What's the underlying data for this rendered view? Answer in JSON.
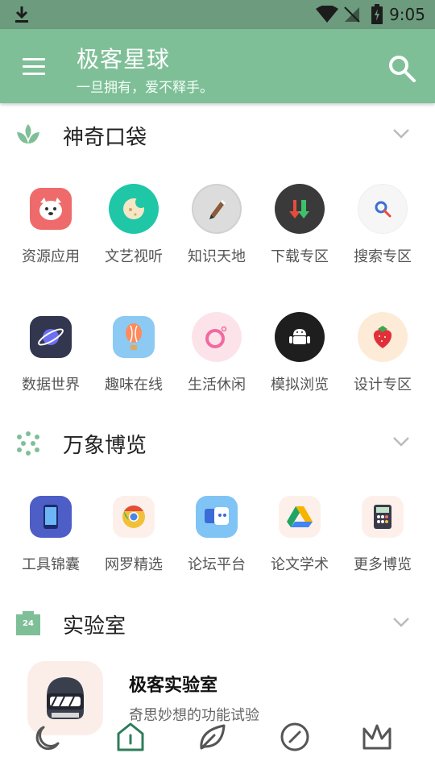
{
  "statusbar": {
    "time": "9:05"
  },
  "appbar": {
    "title": "极客星球",
    "subtitle": "一旦拥有，爱不释手。"
  },
  "sections": [
    {
      "title": "神奇口袋",
      "items": [
        {
          "label": "资源应用",
          "icon": "dog-icon"
        },
        {
          "label": "文艺视听",
          "icon": "moon-cookie-icon"
        },
        {
          "label": "知识天地",
          "icon": "pen-icon"
        },
        {
          "label": "下载专区",
          "icon": "download-arrows-icon"
        },
        {
          "label": "搜索专区",
          "icon": "magnifier-icon"
        },
        {
          "label": "数据世界",
          "icon": "planet-icon"
        },
        {
          "label": "趣味在线",
          "icon": "balloon-icon"
        },
        {
          "label": "生活休闲",
          "icon": "ring-icon"
        },
        {
          "label": "模拟浏览",
          "icon": "android-icon"
        },
        {
          "label": "设计专区",
          "icon": "strawberry-icon"
        }
      ]
    },
    {
      "title": "万象博览",
      "items": [
        {
          "label": "工具锦囊",
          "icon": "phone-icon"
        },
        {
          "label": "网罗精选",
          "icon": "chrome-icon"
        },
        {
          "label": "论坛平台",
          "icon": "chat-icon"
        },
        {
          "label": "论文学术",
          "icon": "drive-icon"
        },
        {
          "label": "更多博览",
          "icon": "calculator-icon"
        }
      ]
    },
    {
      "title": "实验室"
    }
  ],
  "lab": {
    "title": "极客实验室",
    "subtitle": "奇思妙想的功能试验"
  },
  "bottom_tabs": [
    "moon-icon",
    "home-icon",
    "leaf-icon",
    "compass-icon",
    "crown-icon"
  ],
  "colors": {
    "accent": "#7fbf98",
    "status": "#6c9b7d",
    "active_tab": "#2e7d5b"
  }
}
